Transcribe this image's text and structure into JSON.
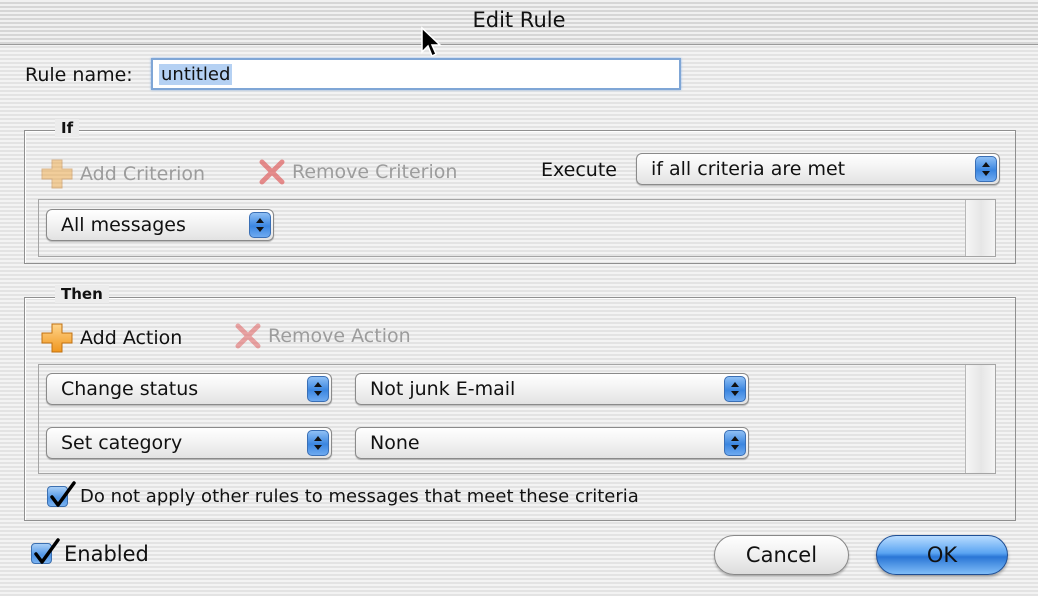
{
  "window": {
    "title": "Edit Rule"
  },
  "rule_name": {
    "label": "Rule name:",
    "value": "untitled"
  },
  "if_section": {
    "title": "If",
    "add_label": "Add Criterion",
    "remove_label": "Remove Criterion",
    "execute_label": "Execute",
    "execute_value": "if all criteria are met",
    "criteria": [
      {
        "field": "All messages"
      }
    ]
  },
  "then_section": {
    "title": "Then",
    "add_label": "Add Action",
    "remove_label": "Remove Action",
    "actions": [
      {
        "action": "Change status",
        "value": "Not junk E-mail"
      },
      {
        "action": "Set category",
        "value": "None"
      }
    ],
    "stop_rules_label": "Do not apply other rules to messages that meet these criteria",
    "stop_rules_checked": true
  },
  "enabled": {
    "label": "Enabled",
    "checked": true
  },
  "buttons": {
    "cancel": "Cancel",
    "ok": "OK"
  },
  "icons": {
    "add": "plus-icon",
    "remove": "x-icon",
    "popup": "popup-arrows-icon",
    "check": "checkmark-icon",
    "cursor": "arrow-cursor-icon"
  },
  "colors": {
    "accent": "#3b86e0",
    "add_icon": "#f0a030",
    "remove_icon": "#e06060"
  }
}
